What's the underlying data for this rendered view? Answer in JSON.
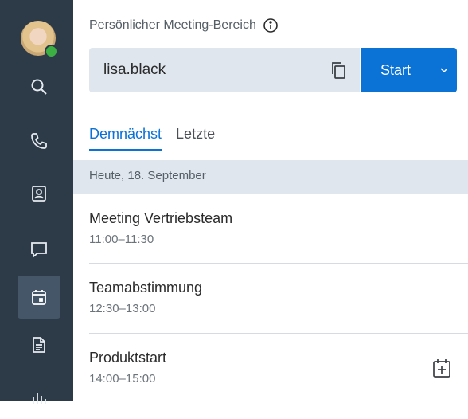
{
  "sidebar": {
    "items": [
      {
        "icon": "search-icon"
      },
      {
        "icon": "phone-icon"
      },
      {
        "icon": "contacts-icon"
      },
      {
        "icon": "chat-icon"
      },
      {
        "icon": "calendar-icon",
        "active": true
      },
      {
        "icon": "document-icon"
      },
      {
        "icon": "analytics-icon"
      }
    ]
  },
  "pmr": {
    "title": "Persönlicher Meeting-Bereich",
    "name": "lisa.black",
    "start_label": "Start"
  },
  "tabs": [
    {
      "label": "Demnächst",
      "active": true
    },
    {
      "label": "Letzte",
      "active": false
    }
  ],
  "day_header": "Heute, 18. September",
  "meetings": [
    {
      "title": "Meeting Vertriebsteam",
      "time": "11:00–11:30"
    },
    {
      "title": "Teamabstimmung",
      "time": "12:30–13:00"
    },
    {
      "title": "Produktstart",
      "time": "14:00–15:00"
    }
  ],
  "colors": {
    "sidebar": "#2d3b49",
    "accent": "#0b72d6",
    "presence": "#3cb043",
    "band": "#dfe6ee"
  }
}
